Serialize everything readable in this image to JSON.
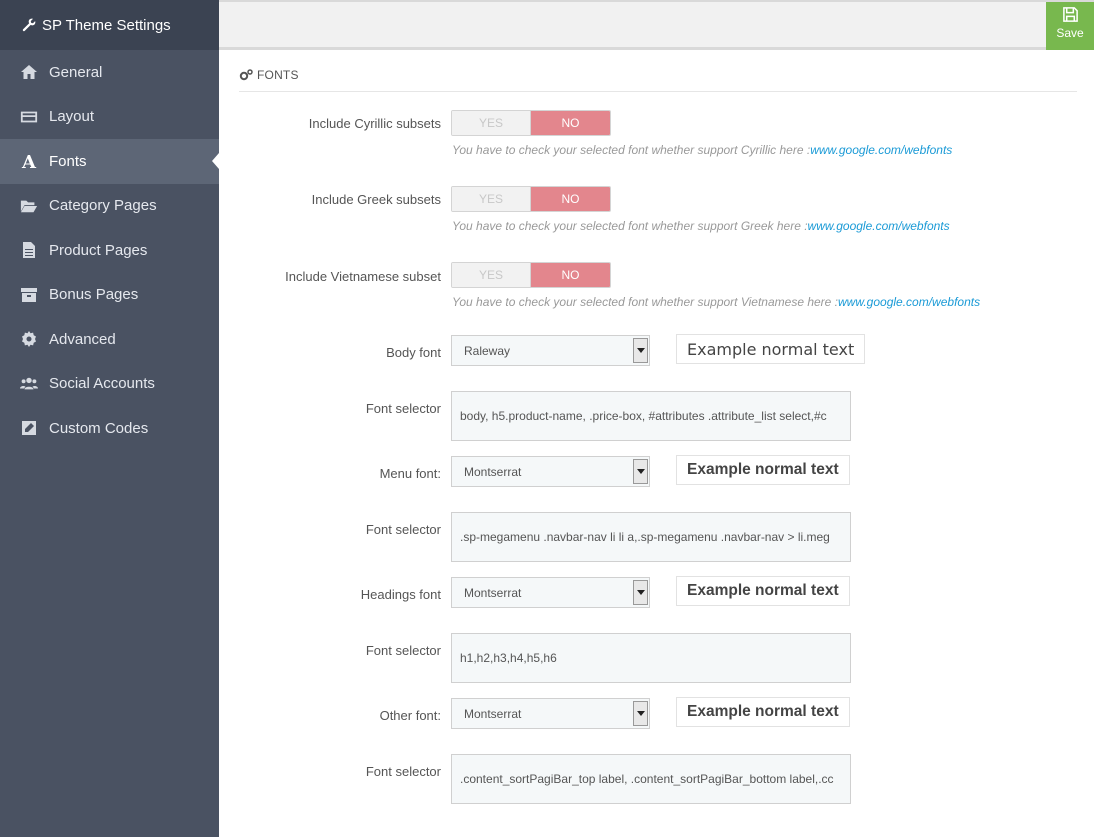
{
  "sidebar": {
    "title": "SP Theme Settings",
    "items": [
      {
        "label": "General",
        "icon": "home-icon"
      },
      {
        "label": "Layout",
        "icon": "credit-card-icon"
      },
      {
        "label": "Fonts",
        "icon": "font-icon",
        "active": true
      },
      {
        "label": "Category Pages",
        "icon": "folder-open-icon"
      },
      {
        "label": "Product Pages",
        "icon": "file-icon"
      },
      {
        "label": "Bonus Pages",
        "icon": "archive-icon"
      },
      {
        "label": "Advanced",
        "icon": "gear-icon"
      },
      {
        "label": "Social Accounts",
        "icon": "users-icon"
      },
      {
        "label": "Custom Codes",
        "icon": "edit-icon"
      }
    ]
  },
  "toolbar": {
    "save_label": "Save",
    "save_icon": "floppy-disk-icon"
  },
  "section": {
    "title": "FONTS",
    "icon": "cogs-icon"
  },
  "subsets": [
    {
      "label": "Include Cyrillic subsets",
      "yes": "YES",
      "no": "NO",
      "value": "NO",
      "help": "You have to check your selected font whether support Cyrillic here :",
      "link": "www.google.com/webfonts"
    },
    {
      "label": "Include Greek subsets",
      "yes": "YES",
      "no": "NO",
      "value": "NO",
      "help": "You have to check your selected font whether support Greek here :",
      "link": "www.google.com/webfonts"
    },
    {
      "label": "Include Vietnamese subset",
      "yes": "YES",
      "no": "NO",
      "value": "NO",
      "help": "You have to check your selected font whether support Vietnamese here :",
      "link": "www.google.com/webfonts"
    }
  ],
  "fonts": [
    {
      "label": "Body font",
      "value": "Raleway",
      "example": "Example normal text",
      "selector_label": "Font selector",
      "selector": "body, h5.product-name, .price-box, #attributes .attribute_list select,#c"
    },
    {
      "label": "Menu font:",
      "value": "Montserrat",
      "example": "Example normal text",
      "selector_label": "Font selector",
      "selector": ".sp-megamenu .navbar-nav  li li a,.sp-megamenu .navbar-nav > li.meg"
    },
    {
      "label": "Headings font",
      "value": "Montserrat",
      "example": "Example normal text",
      "selector_label": "Font selector",
      "selector": "h1,h2,h3,h4,h5,h6"
    },
    {
      "label": "Other font:",
      "value": "Montserrat",
      "example": "Example normal text",
      "selector_label": "Font selector",
      "selector": ".content_sortPagiBar_top label, .content_sortPagiBar_bottom label,.cc"
    }
  ]
}
